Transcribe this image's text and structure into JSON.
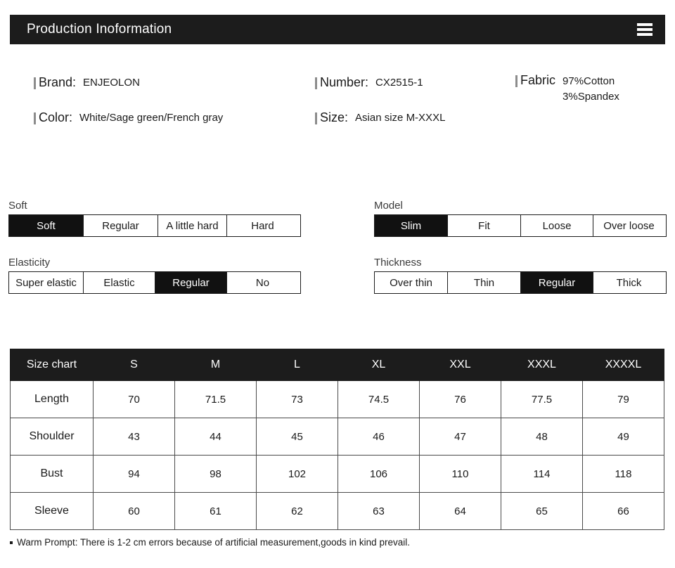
{
  "header": {
    "title": "Production Inoformation",
    "menu_icon": "hamburger-menu-icon"
  },
  "info": {
    "brand": {
      "label": "Brand:",
      "value": "ENJEOLON"
    },
    "color": {
      "label": "Color:",
      "value": "White/Sage green/French gray"
    },
    "number": {
      "label": "Number:",
      "value": "CX2515-1"
    },
    "size": {
      "label": "Size:",
      "value": "Asian size  M-XXXL"
    },
    "fabric": {
      "label": "Fabric",
      "value_line1": "97%Cotton",
      "value_line2": "3%Spandex"
    }
  },
  "scales": [
    {
      "key": "soft",
      "caption": "Soft",
      "options": [
        "Soft",
        "Regular",
        "A little hard",
        "Hard"
      ],
      "selected_index": 0
    },
    {
      "key": "model",
      "caption": "Model",
      "options": [
        "Slim",
        "Fit",
        "Loose",
        "Over loose"
      ],
      "selected_index": 0
    },
    {
      "key": "elasticity",
      "caption": "Elasticity",
      "options": [
        "Super elastic",
        "Elastic",
        "Regular",
        "No"
      ],
      "selected_index": 2
    },
    {
      "key": "thickness",
      "caption": "Thickness",
      "options": [
        "Over thin",
        "Thin",
        "Regular",
        "Thick"
      ],
      "selected_index": 2
    }
  ],
  "size_chart": {
    "headers": [
      "Size chart",
      "S",
      "M",
      "L",
      "XL",
      "XXL",
      "XXXL",
      "XXXXL"
    ],
    "rows": [
      {
        "label": "Length",
        "values": [
          "70",
          "71.5",
          "73",
          "74.5",
          "76",
          "77.5",
          "79"
        ]
      },
      {
        "label": "Shoulder",
        "values": [
          "43",
          "44",
          "45",
          "46",
          "47",
          "48",
          "49"
        ]
      },
      {
        "label": "Bust",
        "values": [
          "94",
          "98",
          "102",
          "106",
          "110",
          "114",
          "118"
        ]
      },
      {
        "label": "Sleeve",
        "values": [
          "60",
          "61",
          "62",
          "63",
          "64",
          "65",
          "66"
        ]
      }
    ]
  },
  "footer": {
    "note": "Warm Prompt: There is 1-2 cm errors because of artificial measurement,goods in kind prevail."
  },
  "colors": {
    "header_bg": "#1c1c1c",
    "selected_bg": "#111111",
    "border": "#4a4a4a",
    "page_bg": "#ffffff"
  }
}
